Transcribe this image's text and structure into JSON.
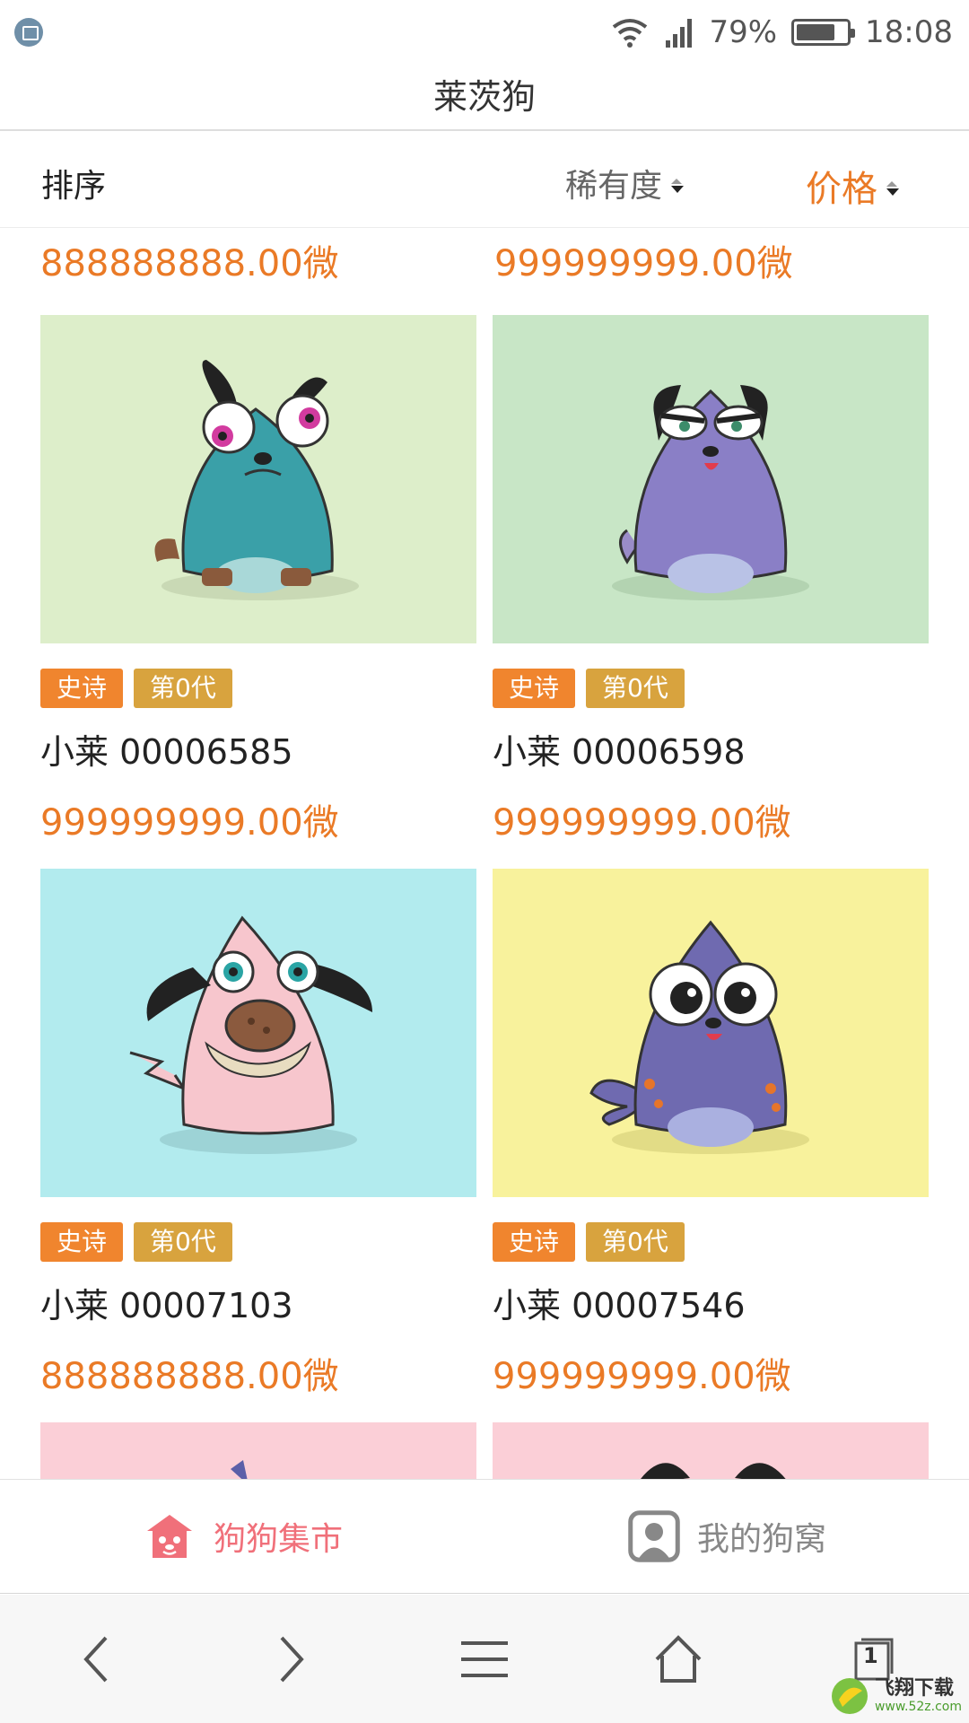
{
  "status_bar": {
    "signal_percent": "79%",
    "time": "18:08"
  },
  "page_title": "莱茨狗",
  "sort_bar": {
    "label": "排序",
    "options": [
      "稀有度",
      "价格"
    ]
  },
  "partial_prices": [
    "888888888.00微",
    "999999999.00微"
  ],
  "cards": [
    {
      "rarity": "史诗",
      "generation": "第0代",
      "name": "小莱 00006585",
      "price": "999999999.00微",
      "bg": "#ddeeca"
    },
    {
      "rarity": "史诗",
      "generation": "第0代",
      "name": "小莱 00006598",
      "price": "999999999.00微",
      "bg": "#c8e6c6"
    },
    {
      "rarity": "史诗",
      "generation": "第0代",
      "name": "小莱 00007103",
      "price": "888888888.00微",
      "bg": "#b2ebee"
    },
    {
      "rarity": "史诗",
      "generation": "第0代",
      "name": "小莱 00007546",
      "price": "999999999.00微",
      "bg": "#f8f29c"
    }
  ],
  "partial_card_bgs": [
    "#fbcfd7",
    "#fbcfd7"
  ],
  "tabs": [
    {
      "label": "狗狗集市",
      "icon": "dog-market-icon",
      "active": true
    },
    {
      "label": "我的狗窝",
      "icon": "user-den-icon",
      "active": false
    }
  ],
  "nav": {
    "tabs_count": "1"
  },
  "watermark": {
    "text": "飞翔下载",
    "url": "www.52z.com"
  }
}
